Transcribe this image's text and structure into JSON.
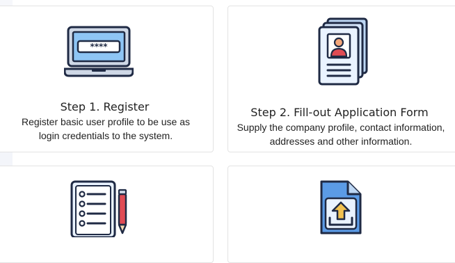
{
  "steps": [
    {
      "icon": "laptop-password-icon",
      "title": "Step 1. Register",
      "description": "Register basic user profile to be use as login credentials to the system."
    },
    {
      "icon": "profile-documents-icon",
      "title": "Step 2. Fill-out Application Form",
      "description": "Supply the company profile, contact information, addresses and other information."
    },
    {
      "icon": "checklist-pencil-icon"
    },
    {
      "icon": "file-upload-icon"
    }
  ],
  "colors": {
    "outline": "#1f2a44",
    "screen": "#8ec5f5",
    "laptop_body": "#cfd8e6",
    "paper": "#eaf3ff",
    "paper_back": "#bcd6f3",
    "avatar_head": "#f4a77a",
    "avatar_body": "#e04b54",
    "pencil": "#e04b54",
    "upload_arrow": "#f2c250",
    "upload_file": "#5b9be6"
  }
}
